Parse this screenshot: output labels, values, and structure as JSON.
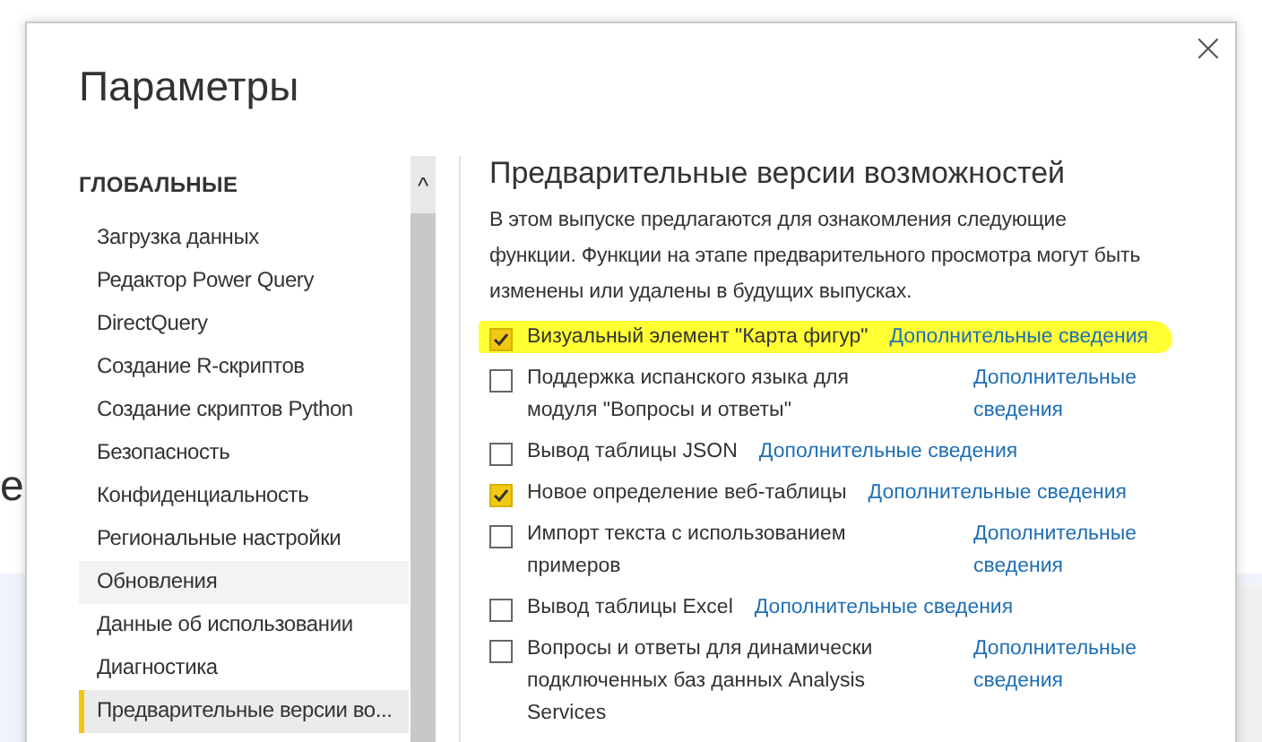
{
  "background": {
    "text": "е"
  },
  "dialog": {
    "title": "Параметры",
    "close": "×"
  },
  "sidebar": {
    "section": "ГЛОБАЛЬНЫЕ",
    "scroll_up": "^",
    "items": [
      {
        "label": "Загрузка данных",
        "selected": false,
        "hovered": false
      },
      {
        "label": "Редактор Power Query",
        "selected": false,
        "hovered": false
      },
      {
        "label": "DirectQuery",
        "selected": false,
        "hovered": false
      },
      {
        "label": "Создание R-скриптов",
        "selected": false,
        "hovered": false
      },
      {
        "label": "Создание скриптов Python",
        "selected": false,
        "hovered": false
      },
      {
        "label": "Безопасность",
        "selected": false,
        "hovered": false
      },
      {
        "label": "Конфиденциальность",
        "selected": false,
        "hovered": false
      },
      {
        "label": "Региональные настройки",
        "selected": false,
        "hovered": false
      },
      {
        "label": "Обновления",
        "selected": false,
        "hovered": true
      },
      {
        "label": "Данные об использовании",
        "selected": false,
        "hovered": false
      },
      {
        "label": "Диагностика",
        "selected": false,
        "hovered": false
      },
      {
        "label": "Предварительные версии во...",
        "selected": true,
        "hovered": false
      }
    ]
  },
  "content": {
    "heading": "Предварительные версии возможностей",
    "description": "В этом выпуске предлагаются для ознакомления следующие функции. Функции на этапе предварительного просмотра могут быть изменены или удалены в будущих выпусках.",
    "options": [
      {
        "kind": "inline",
        "label": "Визуальный элемент \"Карта фигур\"",
        "link": "Дополнительные сведения",
        "checked": true,
        "highlighted": true
      },
      {
        "kind": "wrapped",
        "label": "Поддержка испанского языка для модуля \"Вопросы и ответы\"",
        "link": "Дополнительные сведения",
        "checked": false,
        "highlighted": false
      },
      {
        "kind": "inline",
        "label": "Вывод таблицы JSON",
        "link": "Дополнительные сведения",
        "checked": false,
        "highlighted": false
      },
      {
        "kind": "inline",
        "label": "Новое определение веб-таблицы",
        "link": "Дополнительные сведения",
        "checked": true,
        "highlighted": false
      },
      {
        "kind": "wrapped",
        "label": "Импорт текста с использованием примеров",
        "link": "Дополнительные сведения",
        "checked": false,
        "highlighted": false
      },
      {
        "kind": "inline",
        "label": "Вывод таблицы Excel",
        "link": "Дополнительные сведения",
        "checked": false,
        "highlighted": false
      },
      {
        "kind": "wrapped",
        "label": "Вопросы и ответы для динамически подключенных баз данных Analysis Services",
        "link": "Дополнительные сведения",
        "checked": false,
        "highlighted": false
      }
    ]
  }
}
